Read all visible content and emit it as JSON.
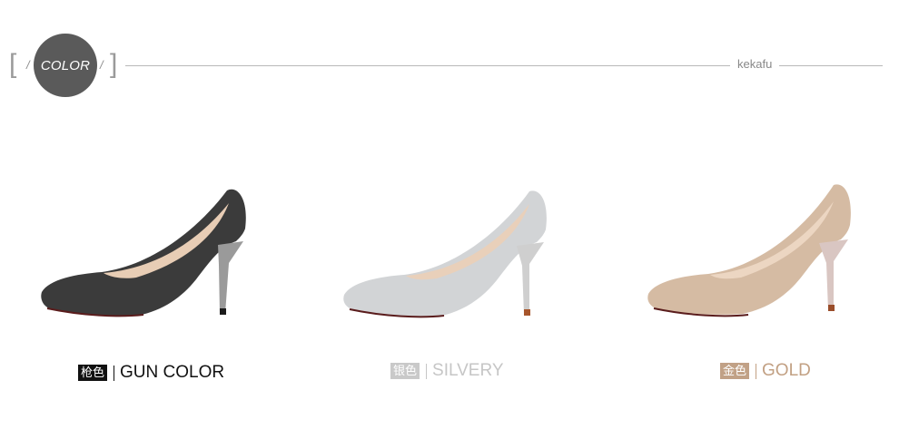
{
  "header": {
    "badge_label": "COLOR",
    "bracket_open": "[",
    "bracket_close": "]",
    "slash_char": "/",
    "brand": "kekafu"
  },
  "variants": [
    {
      "tag": "枪色",
      "name": "GUN COLOR",
      "tag_bg": "#111111",
      "name_color": "#111111",
      "shoe_color": "#3b3b3b",
      "heel_color": "#9a9a9a"
    },
    {
      "tag": "银色",
      "name": "SILVERY",
      "tag_bg": "#c9c9c9",
      "name_color": "#c6c6c6",
      "shoe_color": "#d2d4d6",
      "heel_color": "#cfcfcf"
    },
    {
      "tag": "金色",
      "name": "GOLD",
      "tag_bg": "#c1a186",
      "name_color": "#c2a083",
      "shoe_color": "#d5bba3",
      "heel_color": "#d9c6c2"
    }
  ]
}
